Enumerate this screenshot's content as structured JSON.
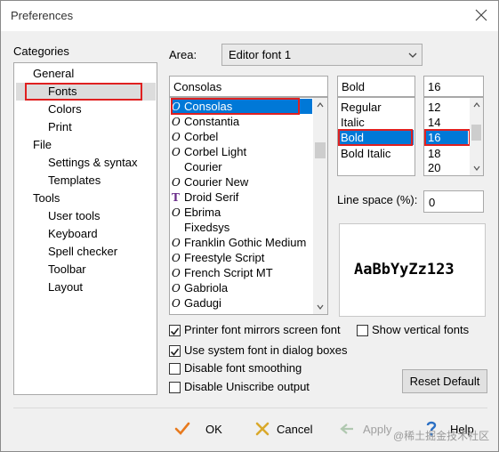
{
  "window": {
    "title": "Preferences"
  },
  "categories": {
    "label": "Categories",
    "items": [
      {
        "label": "General"
      },
      {
        "label": "Fonts"
      },
      {
        "label": "Colors"
      },
      {
        "label": "Print"
      },
      {
        "label": "File"
      },
      {
        "label": "Settings & syntax"
      },
      {
        "label": "Templates"
      },
      {
        "label": "Tools"
      },
      {
        "label": "User tools"
      },
      {
        "label": "Keyboard"
      },
      {
        "label": "Spell checker"
      },
      {
        "label": "Toolbar"
      },
      {
        "label": "Layout"
      }
    ]
  },
  "area": {
    "label": "Area:",
    "value": "Editor font 1"
  },
  "font": {
    "value": "Consolas",
    "list": [
      "Consolas",
      "Constantia",
      "Corbel",
      "Corbel Light",
      "Courier",
      "Courier New",
      "Droid Serif",
      "Ebrima",
      "Fixedsys",
      "Franklin Gothic Medium",
      "Freestyle Script",
      "French Script MT",
      "Gabriola",
      "Gadugi"
    ]
  },
  "style": {
    "value": "Bold",
    "list": [
      "Regular",
      "Italic",
      "Bold",
      "Bold Italic"
    ]
  },
  "size": {
    "value": "16",
    "list": [
      "12",
      "14",
      "16",
      "18",
      "20"
    ]
  },
  "line_space": {
    "label": "Line space (%):",
    "value": "0"
  },
  "preview": {
    "text": "AaBbYyZz123"
  },
  "options": {
    "printer_mirrors": {
      "label": "Printer font mirrors screen font",
      "checked": true
    },
    "show_vertical": {
      "label": "Show vertical fonts",
      "checked": false
    },
    "system_font": {
      "label": "Use system font in dialog boxes",
      "checked": true
    },
    "disable_smoothing": {
      "label": "Disable font smoothing",
      "checked": false
    },
    "disable_uniscribe": {
      "label": "Disable Uniscribe output",
      "checked": false
    }
  },
  "buttons": {
    "reset": "Reset Default",
    "ok": "OK",
    "cancel": "Cancel",
    "apply": "Apply",
    "help": "Help"
  },
  "watermark": "@稀土掘金技术社区",
  "colors": {
    "selection": "#0078d7",
    "highlight_box": "#e02020",
    "ok_check": "#e87a1e"
  }
}
